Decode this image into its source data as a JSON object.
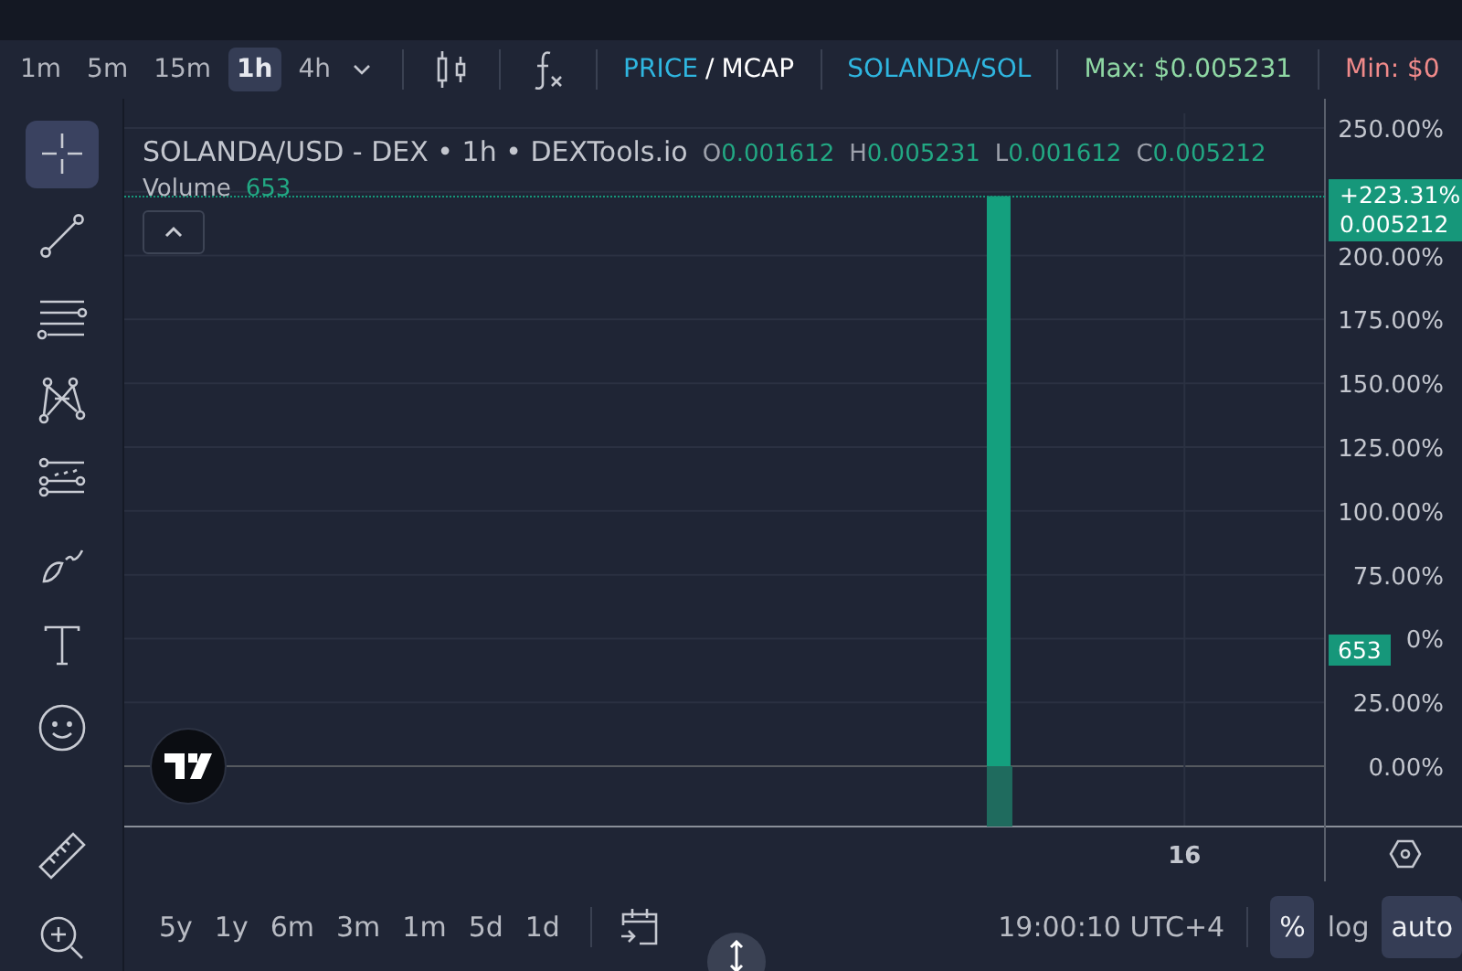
{
  "toolbar": {
    "timeframes": [
      {
        "label": "1m",
        "selected": false
      },
      {
        "label": "5m",
        "selected": false
      },
      {
        "label": "15m",
        "selected": false
      },
      {
        "label": "1h",
        "selected": true
      },
      {
        "label": "4h",
        "selected": false
      }
    ],
    "modes": [
      {
        "label": "PRICE",
        "selected": true
      },
      {
        "label": "MCAP",
        "selected": false
      }
    ],
    "mode_separator": "/",
    "pair": "SOLANDA/SOL",
    "max": "Max: $0.005231",
    "min": "Min: $0"
  },
  "tools": [
    {
      "kind": "crosshair",
      "selected": true
    },
    {
      "kind": "trendline",
      "selected": false
    },
    {
      "kind": "fib",
      "selected": false
    },
    {
      "kind": "pattern",
      "selected": false
    },
    {
      "kind": "projection",
      "selected": false
    },
    {
      "kind": "brush",
      "selected": false
    },
    {
      "kind": "text",
      "selected": false
    },
    {
      "kind": "emoji",
      "selected": false
    },
    {
      "kind": "ruler",
      "selected": false
    },
    {
      "kind": "zoom",
      "selected": false
    }
  ],
  "legend": {
    "title": "SOLANDA/USD - DEX • 1h • DEXTools.io",
    "ohlc": [
      {
        "key": "O",
        "value": "0.001612"
      },
      {
        "key": "H",
        "value": "0.005231"
      },
      {
        "key": "L",
        "value": "0.001612"
      },
      {
        "key": "C",
        "value": "0.005212"
      }
    ],
    "volume_label": "Volume",
    "volume_value": "653"
  },
  "price_tag": {
    "change": "+223.31%",
    "price": "0.005212"
  },
  "volume_tag": "653",
  "covered_axis_label": "0%",
  "chart_data": {
    "type": "bar",
    "values": [
      223.3
    ],
    "ylim": [
      -23.6,
      255.7
    ],
    "grid": true,
    "annotations": [
      {
        "text": "16"
      }
    ],
    "yticks": [
      {
        "value": 0,
        "label": "0.00%"
      },
      {
        "value": 25,
        "label": "25.00%"
      },
      {
        "value": 75,
        "label": "75.00%"
      },
      {
        "value": 100,
        "label": "100.00%"
      },
      {
        "value": 125,
        "label": "125.00%"
      },
      {
        "value": 150,
        "label": "150.00%"
      },
      {
        "value": 175,
        "label": "175.00%"
      },
      {
        "value": 200,
        "label": "200.00%"
      },
      {
        "value": 250,
        "label": "250.00%"
      }
    ]
  },
  "ranges": [
    "5y",
    "1y",
    "6m",
    "3m",
    "1m",
    "5d",
    "1d"
  ],
  "clock": "19:00:10 UTC+4",
  "scale_buttons": [
    {
      "label": "%",
      "selected": true
    },
    {
      "label": "log",
      "selected": false
    },
    {
      "label": "auto",
      "selected": true
    }
  ]
}
